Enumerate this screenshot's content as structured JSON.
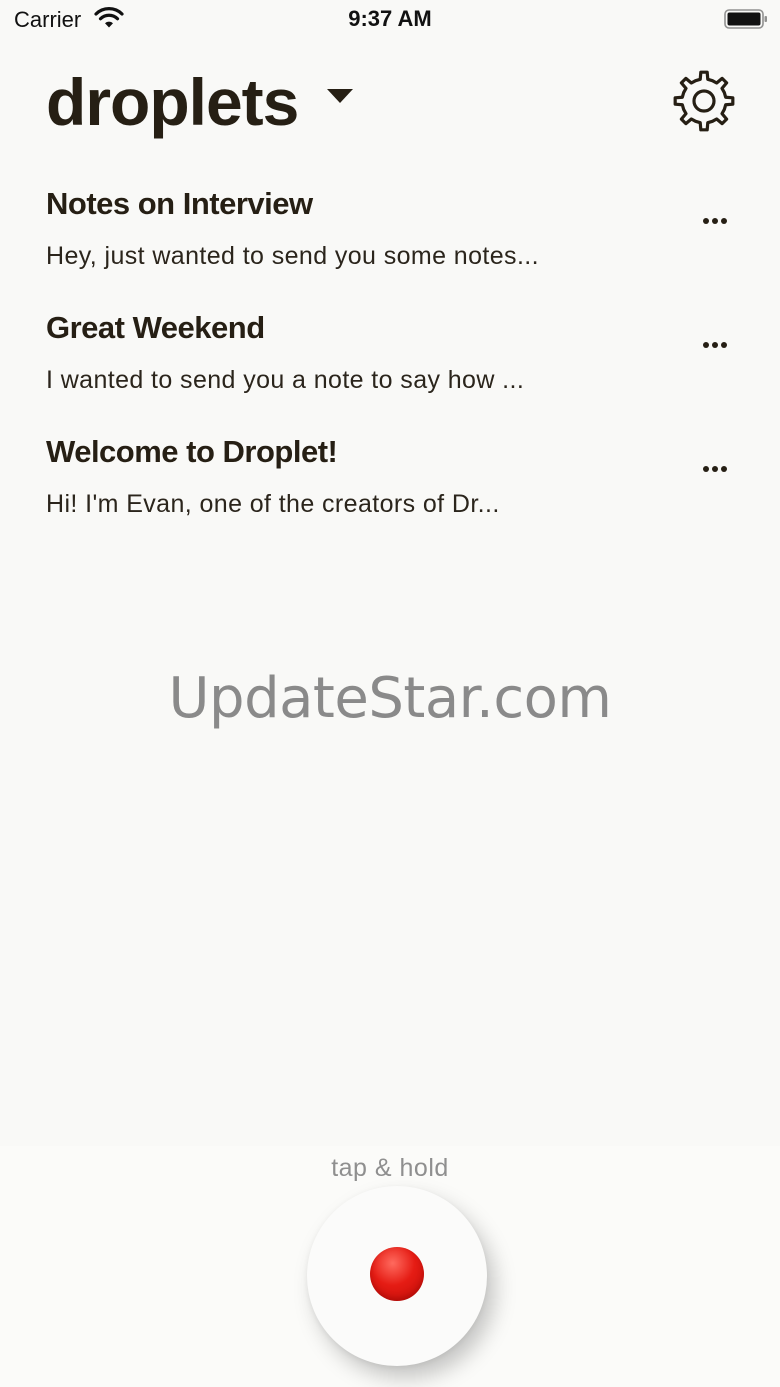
{
  "status_bar": {
    "carrier": "Carrier",
    "time": "9:37 AM",
    "icons": [
      "wifi-icon",
      "battery-icon"
    ]
  },
  "header": {
    "title": "droplets",
    "dropdown_icon": "caret-down-icon",
    "settings_icon": "gear-icon"
  },
  "notes": [
    {
      "title": "Notes on Interview",
      "preview": "Hey, just wanted to send you some notes..."
    },
    {
      "title": "Great Weekend",
      "preview": "I wanted to send you a note to say how ..."
    },
    {
      "title": "Welcome to Droplet!",
      "preview": "Hi! I'm Evan, one of the creators of Dr..."
    }
  ],
  "watermark": "UpdateStar.com",
  "record": {
    "hint": "tap & hold",
    "icon": "record-icon"
  },
  "colors": {
    "background": "#f9f9f7",
    "text_primary": "#261f14",
    "record_red": "#e51c14",
    "hint_gray": "#8f8f8f"
  }
}
